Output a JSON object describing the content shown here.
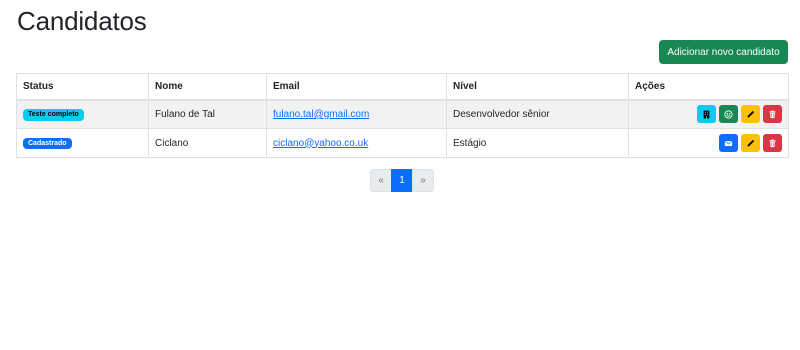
{
  "page": {
    "title": "Candidatos"
  },
  "toolbar": {
    "add_label": "Adicionar novo candidato"
  },
  "table": {
    "headers": [
      "Status",
      "Nome",
      "Email",
      "Nível",
      "Ações"
    ],
    "rows": [
      {
        "status": {
          "label": "Teste completo",
          "bg": "#0dcaf0",
          "color": "#000000"
        },
        "name": "Fulano de Tal",
        "email": "fulano.tal@gmail.com",
        "level": "Desenvolvedor sênior",
        "actions": [
          {
            "icon": "building-icon",
            "color": "#0dcaf0"
          },
          {
            "icon": "emoji-icon",
            "color": "#198754"
          },
          {
            "icon": "pencil-icon",
            "color": "#ffc107"
          },
          {
            "icon": "trash-icon",
            "color": "#dc3545"
          }
        ]
      },
      {
        "status": {
          "label": "Cadastrado",
          "bg": "#0d6efd",
          "color": "#ffffff"
        },
        "name": "Ciclano",
        "email": "ciclano@yahoo.co.uk",
        "level": "Estágio",
        "actions": [
          {
            "icon": "envelope-icon",
            "color": "#0d6efd"
          },
          {
            "icon": "pencil-icon",
            "color": "#ffc107"
          },
          {
            "icon": "trash-icon",
            "color": "#dc3545"
          }
        ]
      }
    ]
  },
  "pagination": {
    "prev": "«",
    "current": "1",
    "next": "»"
  }
}
